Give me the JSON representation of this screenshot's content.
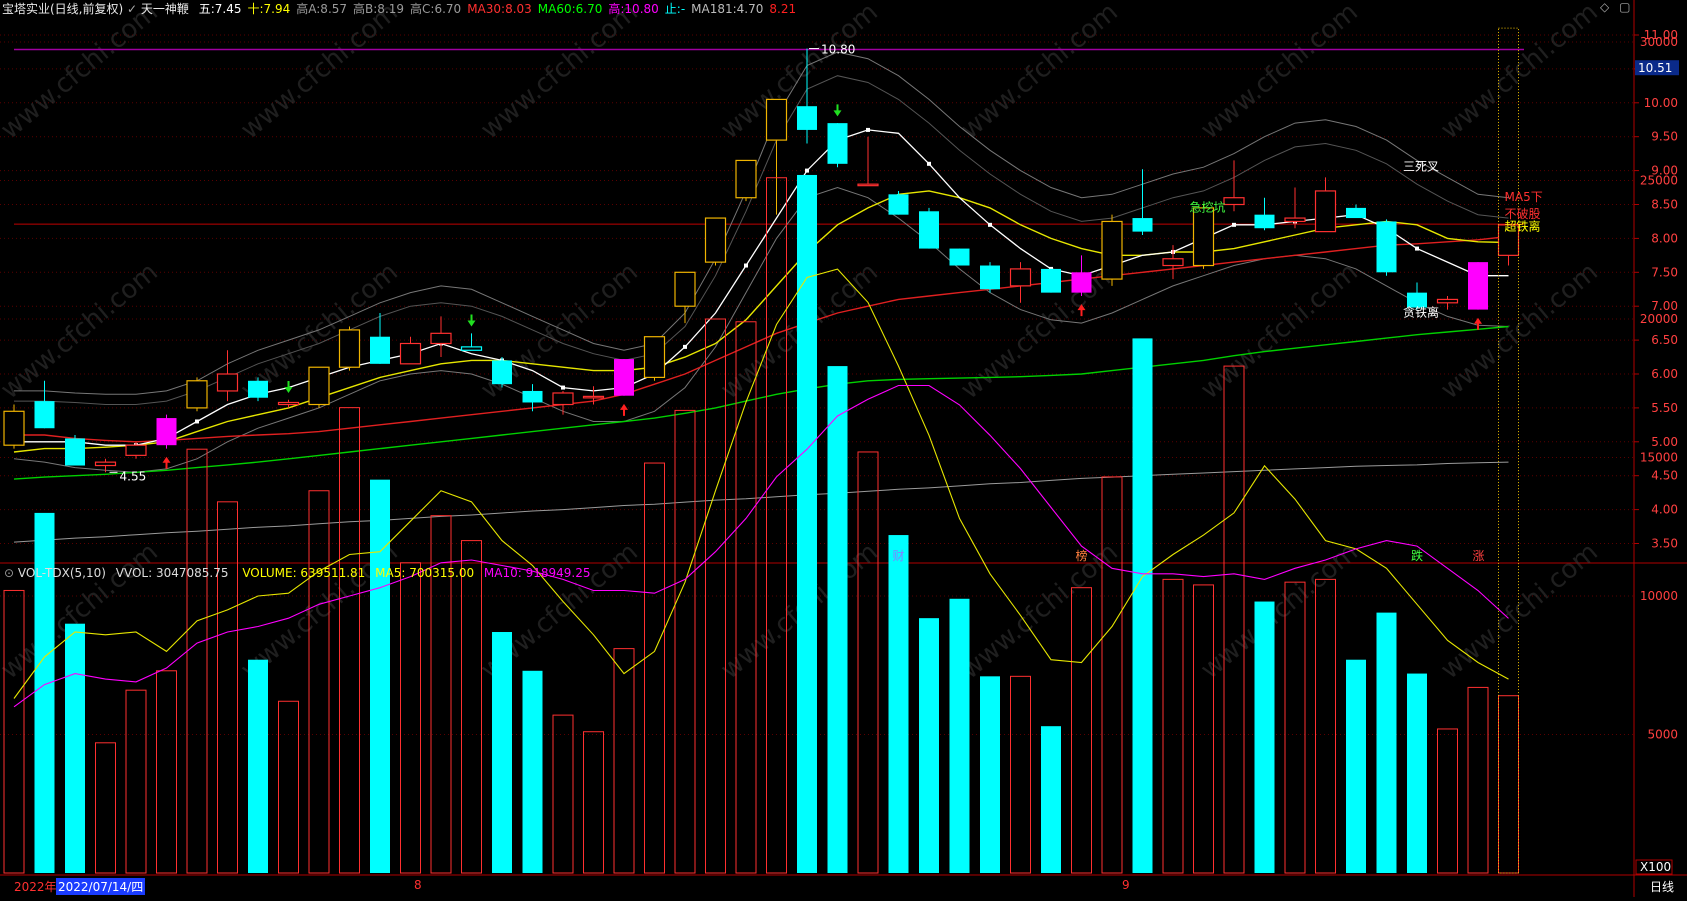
{
  "header": {
    "title": "宝塔实业(日线,前复权)",
    "indicator": "天一神鞭",
    "items": [
      {
        "label": "五:",
        "value": "7.45",
        "color": "#ffffff"
      },
      {
        "label": "十:",
        "value": "7.94",
        "color": "#ffff00"
      },
      {
        "label": "高A:",
        "value": "8.57",
        "color": "#9a9a9a"
      },
      {
        "label": "高B:",
        "value": "8.19",
        "color": "#9a9a9a"
      },
      {
        "label": "高C:",
        "value": "6.70",
        "color": "#9a9a9a"
      },
      {
        "label": "MA30:",
        "value": "8.03",
        "color": "#ff3030"
      },
      {
        "label": "MA60:",
        "value": "6.70",
        "color": "#00ff00"
      },
      {
        "label": "高:",
        "value": "10.80",
        "color": "#ff00ff"
      },
      {
        "label": "止:",
        "value": "-",
        "color": "#00ffff"
      },
      {
        "label": "MA181:",
        "value": "4.70",
        "color": "#bbbbbb"
      },
      {
        "label": "",
        "value": "8.21",
        "color": "#ff2020"
      }
    ]
  },
  "vol_header": {
    "name": "VOL-TDX(5,10)",
    "vvol": "VVOL: 3047085.75",
    "volume": "VOLUME: 639511.81",
    "ma5": "MA5: 700315.00",
    "ma10": "MA10: 918949.25"
  },
  "price_axis": {
    "ticks": [
      "11.00",
      "10.50",
      "10.00",
      "9.50",
      "9.00",
      "8.50",
      "8.00",
      "7.50",
      "7.00",
      "6.50",
      "6.00",
      "5.50",
      "5.00",
      "4.50",
      "4.00",
      "3.50"
    ],
    "current": "10.51"
  },
  "vol_axis": {
    "ticks": [
      "30000",
      "25000",
      "20000",
      "15000",
      "10000",
      "5000"
    ],
    "unit": "X100"
  },
  "footer": {
    "year": "2022年",
    "date": "2022/07/14/四",
    "months": [
      "8",
      "9"
    ],
    "period": "日线"
  },
  "watermark": "www.cfchi.com",
  "annotations": {
    "high": "10.80",
    "low": "4.55",
    "texts": [
      "急挖坑",
      "三死叉",
      "贪铁离",
      "MA5下",
      "不破股",
      "超铁离"
    ],
    "events": [
      "财",
      "榜",
      "跌",
      "涨"
    ]
  },
  "chart_data": {
    "type": "candlestick",
    "title": "宝塔实业(日线,前复权)",
    "ylim": [
      3.3,
      11.3
    ],
    "vol_ylim": [
      0,
      32000
    ],
    "candles": [
      {
        "o": 4.95,
        "h": 5.55,
        "l": 4.9,
        "c": 5.45,
        "v": 10200
      },
      {
        "o": 5.6,
        "h": 5.9,
        "l": 5.2,
        "c": 5.2,
        "v": 13000
      },
      {
        "o": 5.05,
        "h": 5.1,
        "l": 4.65,
        "c": 4.65,
        "v": 9000
      },
      {
        "o": 4.65,
        "h": 4.75,
        "l": 4.55,
        "c": 4.7,
        "v": 4700
      },
      {
        "o": 4.8,
        "h": 5.0,
        "l": 4.75,
        "c": 4.95,
        "v": 6600
      },
      {
        "o": 4.95,
        "h": 5.4,
        "l": 4.9,
        "c": 5.35,
        "v": 7300
      },
      {
        "o": 5.5,
        "h": 5.95,
        "l": 5.45,
        "c": 5.9,
        "v": 15300
      },
      {
        "o": 5.75,
        "h": 6.35,
        "l": 5.6,
        "c": 6.0,
        "v": 13400
      },
      {
        "o": 5.9,
        "h": 5.95,
        "l": 5.6,
        "c": 5.65,
        "v": 7700
      },
      {
        "o": 5.55,
        "h": 5.62,
        "l": 5.5,
        "c": 5.58,
        "v": 6200
      },
      {
        "o": 5.55,
        "h": 6.1,
        "l": 5.5,
        "c": 6.1,
        "v": 13800
      },
      {
        "o": 6.1,
        "h": 6.7,
        "l": 6.05,
        "c": 6.65,
        "v": 16800
      },
      {
        "o": 6.55,
        "h": 6.9,
        "l": 6.15,
        "c": 6.15,
        "v": 14200
      },
      {
        "o": 6.15,
        "h": 6.55,
        "l": 6.15,
        "c": 6.45,
        "v": 11200
      },
      {
        "o": 6.45,
        "h": 6.85,
        "l": 6.25,
        "c": 6.6,
        "v": 12900
      },
      {
        "o": 6.4,
        "h": 6.6,
        "l": 6.35,
        "c": 6.35,
        "v": 12000
      },
      {
        "o": 6.2,
        "h": 6.25,
        "l": 5.8,
        "c": 5.85,
        "v": 8700
      },
      {
        "o": 5.75,
        "h": 5.85,
        "l": 5.45,
        "c": 5.58,
        "v": 7300
      },
      {
        "o": 5.55,
        "h": 5.75,
        "l": 5.4,
        "c": 5.72,
        "v": 5700
      },
      {
        "o": 5.66,
        "h": 5.82,
        "l": 5.55,
        "c": 5.67,
        "v": 5100
      },
      {
        "o": 5.68,
        "h": 6.22,
        "l": 5.68,
        "c": 6.22,
        "v": 8100
      },
      {
        "o": 5.95,
        "h": 6.55,
        "l": 5.9,
        "c": 6.55,
        "v": 14800
      },
      {
        "o": 7.0,
        "h": 7.5,
        "l": 6.75,
        "c": 7.5,
        "v": 16700
      },
      {
        "o": 7.65,
        "h": 8.3,
        "l": 7.6,
        "c": 8.3,
        "v": 20000
      },
      {
        "o": 8.6,
        "h": 9.15,
        "l": 8.55,
        "c": 9.15,
        "v": 19900
      },
      {
        "o": 9.45,
        "h": 10.05,
        "l": 8.35,
        "c": 10.05,
        "v": 25100
      },
      {
        "o": 9.95,
        "h": 10.8,
        "l": 9.4,
        "c": 9.6,
        "v": 25200
      },
      {
        "o": 9.7,
        "h": 9.7,
        "l": 9.05,
        "c": 9.1,
        "v": 18300
      },
      {
        "o": 8.8,
        "h": 9.5,
        "l": 8.8,
        "c": 8.8,
        "v": 15200
      },
      {
        "o": 8.65,
        "h": 8.7,
        "l": 8.35,
        "c": 8.35,
        "v": 12200
      },
      {
        "o": 8.4,
        "h": 8.45,
        "l": 7.85,
        "c": 7.85,
        "v": 9200
      },
      {
        "o": 7.85,
        "h": 7.85,
        "l": 7.6,
        "c": 7.6,
        "v": 9900
      },
      {
        "o": 7.6,
        "h": 7.65,
        "l": 7.2,
        "c": 7.25,
        "v": 7100
      },
      {
        "o": 7.3,
        "h": 7.65,
        "l": 7.05,
        "c": 7.55,
        "v": 7100
      },
      {
        "o": 7.55,
        "h": 7.55,
        "l": 7.2,
        "c": 7.2,
        "v": 5300
      },
      {
        "o": 7.5,
        "h": 7.75,
        "l": 7.15,
        "c": 7.2,
        "v": 10300
      },
      {
        "o": 7.4,
        "h": 8.35,
        "l": 7.3,
        "c": 8.25,
        "v": 14300
      },
      {
        "o": 8.3,
        "h": 9.02,
        "l": 8.05,
        "c": 8.1,
        "v": 19300
      },
      {
        "o": 7.6,
        "h": 7.9,
        "l": 7.4,
        "c": 7.7,
        "v": 10600
      },
      {
        "o": 7.6,
        "h": 8.5,
        "l": 7.55,
        "c": 8.45,
        "v": 10400
      },
      {
        "o": 8.5,
        "h": 9.15,
        "l": 8.4,
        "c": 8.6,
        "v": 18300
      },
      {
        "o": 8.35,
        "h": 8.6,
        "l": 8.12,
        "c": 8.15,
        "v": 9800
      },
      {
        "o": 8.25,
        "h": 8.75,
        "l": 8.15,
        "c": 8.3,
        "v": 10500
      },
      {
        "o": 8.1,
        "h": 8.9,
        "l": 8.1,
        "c": 8.7,
        "v": 10600
      },
      {
        "o": 8.45,
        "h": 8.5,
        "l": 8.3,
        "c": 8.3,
        "v": 7700
      },
      {
        "o": 8.25,
        "h": 8.28,
        "l": 7.45,
        "c": 7.5,
        "v": 9400
      },
      {
        "o": 7.2,
        "h": 7.35,
        "l": 6.95,
        "c": 6.98,
        "v": 7200
      },
      {
        "o": 7.05,
        "h": 7.15,
        "l": 6.95,
        "c": 7.1,
        "v": 5200
      },
      {
        "o": 7.65,
        "h": 7.65,
        "l": 6.95,
        "c": 6.95,
        "v": 6700
      },
      {
        "o": 7.75,
        "h": 8.2,
        "l": 7.6,
        "c": 8.2,
        "v": 6400
      }
    ],
    "fill_colors": {
      "50": "#00ffff",
      "1": "#00ffff",
      "2": "#00ffff",
      "8": "#00ffff",
      "12": "#00ffff",
      "16": "#00ffff",
      "17": "#00ffff",
      "26": "#00ffff",
      "27": "#00ffff",
      "29": "#00ffff",
      "30": "#00ffff",
      "31": "#00ffff",
      "32": "#00ffff",
      "34": "#00ffff",
      "37": "#00ffff",
      "41": "#00ffff",
      "44": "#00ffff",
      "45": "#00ffff",
      "46": "#00ffff",
      "5": "#ff00ff",
      "20": "#ff00ff",
      "35": "#ff00ff",
      "48": "#ff00ff"
    },
    "gold_outline": [
      0,
      6,
      10,
      11,
      21,
      22,
      23,
      24,
      25,
      36,
      39
    ],
    "ma5": [
      5.0,
      5.0,
      5.0,
      4.95,
      4.95,
      5.05,
      5.3,
      5.55,
      5.7,
      5.8,
      5.95,
      6.1,
      6.2,
      6.3,
      6.45,
      6.3,
      6.2,
      6.05,
      5.8,
      5.75,
      5.8,
      6.0,
      6.4,
      6.9,
      7.6,
      8.3,
      9.0,
      9.45,
      9.6,
      9.55,
      9.1,
      8.6,
      8.2,
      7.85,
      7.55,
      7.45,
      7.6,
      7.75,
      7.8,
      8.0,
      8.2,
      8.2,
      8.25,
      8.3,
      8.35,
      8.15,
      7.85,
      7.65,
      7.45,
      7.45
    ],
    "ma10": [
      4.85,
      4.9,
      4.9,
      4.92,
      4.95,
      5.0,
      5.15,
      5.3,
      5.4,
      5.5,
      5.65,
      5.8,
      5.95,
      6.05,
      6.15,
      6.2,
      6.2,
      6.15,
      6.1,
      6.05,
      6.05,
      6.1,
      6.25,
      6.45,
      6.8,
      7.3,
      7.8,
      8.2,
      8.45,
      8.65,
      8.7,
      8.6,
      8.45,
      8.2,
      8.0,
      7.85,
      7.75,
      7.75,
      7.8,
      7.8,
      7.85,
      7.95,
      8.05,
      8.15,
      8.2,
      8.25,
      8.2,
      8.0,
      7.95,
      7.94
    ],
    "ma30": [
      5.1,
      5.1,
      5.05,
      5.02,
      5.0,
      5.02,
      5.05,
      5.08,
      5.1,
      5.12,
      5.15,
      5.2,
      5.25,
      5.3,
      5.35,
      5.4,
      5.45,
      5.5,
      5.55,
      5.6,
      5.7,
      5.85,
      6.0,
      6.2,
      6.4,
      6.6,
      6.75,
      6.9,
      7.0,
      7.1,
      7.15,
      7.2,
      7.25,
      7.3,
      7.35,
      7.4,
      7.45,
      7.5,
      7.55,
      7.6,
      7.65,
      7.7,
      7.75,
      7.8,
      7.85,
      7.9,
      7.92,
      7.95,
      7.98,
      8.03
    ],
    "ma60": [
      4.45,
      4.48,
      4.5,
      4.52,
      4.55,
      4.58,
      4.62,
      4.66,
      4.7,
      4.75,
      4.8,
      4.85,
      4.9,
      4.95,
      5.0,
      5.05,
      5.1,
      5.15,
      5.2,
      5.25,
      5.3,
      5.35,
      5.42,
      5.5,
      5.6,
      5.7,
      5.78,
      5.85,
      5.9,
      5.92,
      5.93,
      5.94,
      5.95,
      5.96,
      5.98,
      6.0,
      6.05,
      6.1,
      6.15,
      6.2,
      6.27,
      6.33,
      6.38,
      6.43,
      6.48,
      6.53,
      6.58,
      6.62,
      6.66,
      6.7
    ],
    "ma181": [
      3.52,
      3.55,
      3.58,
      3.6,
      3.63,
      3.66,
      3.68,
      3.71,
      3.74,
      3.76,
      3.79,
      3.82,
      3.84,
      3.87,
      3.9,
      3.92,
      3.95,
      3.98,
      4.0,
      4.03,
      4.06,
      4.08,
      4.11,
      4.14,
      4.16,
      4.19,
      4.22,
      4.24,
      4.27,
      4.3,
      4.32,
      4.35,
      4.38,
      4.4,
      4.43,
      4.46,
      4.48,
      4.5,
      4.52,
      4.54,
      4.56,
      4.58,
      4.6,
      4.62,
      4.64,
      4.65,
      4.66,
      4.68,
      4.69,
      4.7
    ],
    "band_upper": [
      5.75,
      5.75,
      5.72,
      5.7,
      5.7,
      5.75,
      5.9,
      6.15,
      6.35,
      6.5,
      6.65,
      6.85,
      7.05,
      7.2,
      7.3,
      7.25,
      7.05,
      6.85,
      6.65,
      6.45,
      6.35,
      6.45,
      6.9,
      7.7,
      8.7,
      9.8,
      10.55,
      10.75,
      10.65,
      10.4,
      10.05,
      9.65,
      9.3,
      9.0,
      8.75,
      8.6,
      8.65,
      8.8,
      8.95,
      9.05,
      9.25,
      9.5,
      9.7,
      9.75,
      9.65,
      9.45,
      9.15,
      8.9,
      8.65,
      8.6
    ],
    "band_lower": [
      4.75,
      4.7,
      4.62,
      4.58,
      4.55,
      4.6,
      4.75,
      5.0,
      5.2,
      5.35,
      5.5,
      5.7,
      5.9,
      6.0,
      6.05,
      6.0,
      5.85,
      5.65,
      5.45,
      5.3,
      5.3,
      5.45,
      5.8,
      6.4,
      7.2,
      8.0,
      8.6,
      8.75,
      8.6,
      8.3,
      7.95,
      7.55,
      7.2,
      6.95,
      6.8,
      6.75,
      6.9,
      7.1,
      7.3,
      7.45,
      7.6,
      7.7,
      7.75,
      7.7,
      7.55,
      7.3,
      7.05,
      6.85,
      6.72,
      6.7
    ],
    "band2_upper": [
      5.6,
      5.6,
      5.58,
      5.55,
      5.55,
      5.6,
      5.75,
      5.95,
      6.15,
      6.3,
      6.45,
      6.65,
      6.85,
      7.0,
      7.05,
      7.0,
      6.85,
      6.65,
      6.45,
      6.3,
      6.2,
      6.3,
      6.7,
      7.45,
      8.4,
      9.45,
      10.2,
      10.4,
      10.3,
      10.05,
      9.7,
      9.3,
      8.95,
      8.65,
      8.4,
      8.25,
      8.3,
      8.45,
      8.6,
      8.7,
      8.9,
      9.15,
      9.35,
      9.4,
      9.3,
      9.1,
      8.8,
      8.55,
      8.35,
      8.3
    ],
    "vol_ma5": [
      6300,
      7800,
      8700,
      8600,
      8700,
      8000,
      9100,
      9500,
      10000,
      10100,
      10900,
      11500,
      11600,
      12700,
      13800,
      13400,
      12000,
      11100,
      9800,
      8600,
      7200,
      8000,
      10500,
      13800,
      17000,
      19800,
      21500,
      21800,
      20600,
      18300,
      15800,
      12800,
      10800,
      9300,
      7700,
      7600,
      8900,
      10700,
      11500,
      12200,
      13000,
      14700,
      13500,
      12000,
      11700,
      11000,
      9700,
      8400,
      7600,
      7000
    ],
    "vol_ma10": [
      6000,
      6800,
      7200,
      7000,
      6900,
      7400,
      8300,
      8700,
      8900,
      9200,
      9700,
      10000,
      10300,
      10700,
      11200,
      11300,
      11100,
      10900,
      10600,
      10200,
      10200,
      10100,
      10600,
      11600,
      12800,
      14300,
      15300,
      16500,
      17100,
      17600,
      17600,
      16900,
      15800,
      14600,
      13200,
      11800,
      11000,
      10800,
      10800,
      10700,
      10800,
      10600,
      11000,
      11300,
      11700,
      12000,
      11800,
      11000,
      10200,
      9190
    ]
  }
}
